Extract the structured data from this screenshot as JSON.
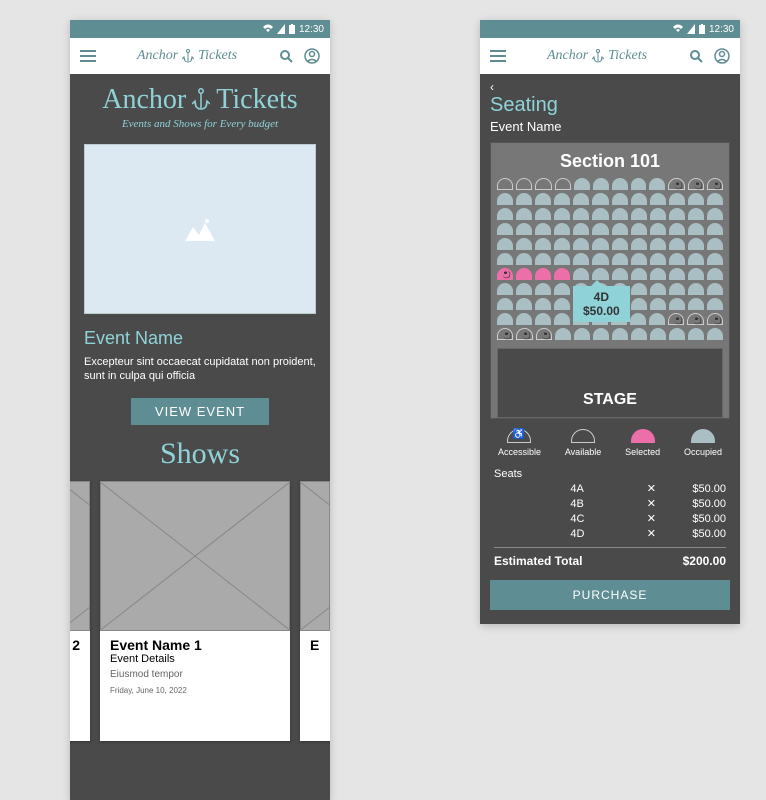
{
  "statusbar": {
    "time": "12:30"
  },
  "appbar": {
    "brand_left": "Anchor",
    "brand_right": "Tickets"
  },
  "home": {
    "hero_title_left": "Anchor",
    "hero_title_right": "Tickets",
    "hero_tag": "Events and Shows for Every budget",
    "event_name": "Event Name",
    "event_desc": "Excepteur sint occaecat cupidatat non proident, sunt in culpa qui officia",
    "view_btn": "VIEW EVENT",
    "shows_heading": "Shows",
    "card_partial_left_suffix": "2",
    "card": {
      "title": "Event Name 1",
      "subtitle": "Event Details",
      "detail": "Eiusmod tempor",
      "date": "Friday, June 10, 2022"
    },
    "card_partial_right_prefix": "E"
  },
  "seating": {
    "back": "‹",
    "title": "Seating",
    "event_name": "Event Name",
    "section": "Section 101",
    "tooltip_seat": "4D",
    "tooltip_price": "$50.00",
    "stage": "STAGE",
    "legend": {
      "accessible": "Accessible",
      "available": "Available",
      "selected": "Selected",
      "occupied": "Occupied"
    },
    "seats_label": "Seats",
    "rows": [
      {
        "seat": "4A",
        "price": "$50.00"
      },
      {
        "seat": "4B",
        "price": "$50.00"
      },
      {
        "seat": "4C",
        "price": "$50.00"
      },
      {
        "seat": "4D",
        "price": "$50.00"
      }
    ],
    "total_label": "Estimated Total",
    "total_value": "$200.00",
    "purchase": "PURCHASE"
  }
}
